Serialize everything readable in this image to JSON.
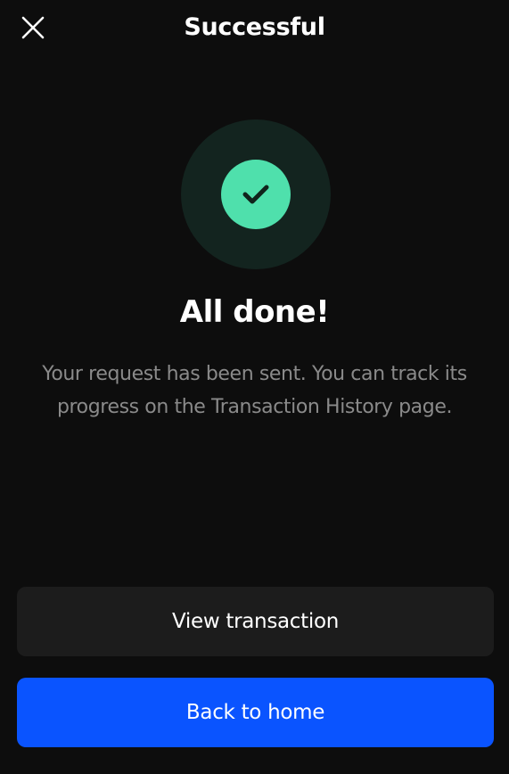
{
  "header": {
    "title": "Successful",
    "close_icon": "close-icon"
  },
  "status": {
    "icon": "checkmark-icon",
    "title": "All done!",
    "message": "Your request has been sent. You can track its progress on the Transaction History page.",
    "accent_color": "#4fe0ac"
  },
  "actions": {
    "view_transaction_label": "View transaction",
    "back_home_label": "Back to home",
    "primary_color": "#0a54ff"
  }
}
